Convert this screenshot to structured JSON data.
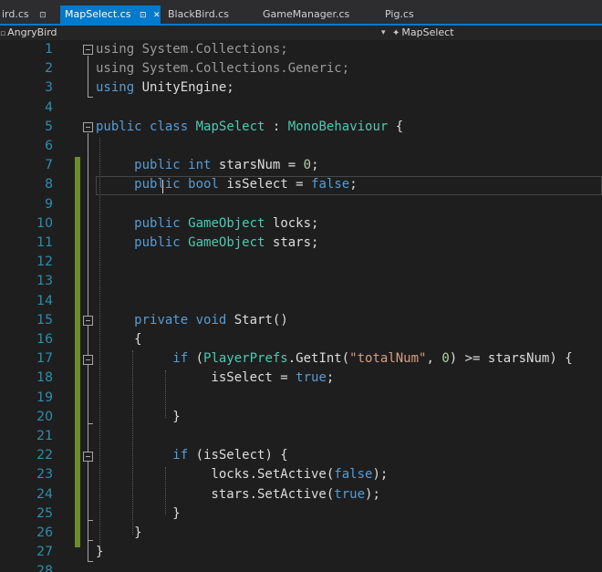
{
  "tabs": [
    {
      "label": "ird.cs",
      "icon": "pin-icon",
      "active": false
    },
    {
      "label": "MapSelect.cs",
      "icon": "pin-icon",
      "active": true
    },
    {
      "label": "BlackBird.cs",
      "active": false
    },
    {
      "label": "GameManager.cs",
      "active": false
    },
    {
      "label": "Pig.cs",
      "active": false
    }
  ],
  "navbar": {
    "project": "AngryBird",
    "member": "MapSelect",
    "dropdown_glyph": "▾"
  },
  "editor": {
    "theme": {
      "keyword": "#569cd6",
      "type": "#4ec9b0",
      "string": "#d69d85",
      "number": "#b5cea8",
      "line_number": "#2b91af",
      "text": "#dcdcdc",
      "changed": "#6a8d2c"
    },
    "lines": [
      {
        "num": "1",
        "tokens": [
          [
            "u",
            "using"
          ],
          [
            "u",
            " System.Collections;"
          ]
        ]
      },
      {
        "num": "2",
        "tokens": [
          [
            "u",
            "using"
          ],
          [
            "u",
            " System.Collections.Generic;"
          ]
        ]
      },
      {
        "num": "3",
        "tokens": [
          [
            "k",
            "using"
          ],
          [
            "p",
            " UnityEngine;"
          ]
        ]
      },
      {
        "num": "4",
        "tokens": []
      },
      {
        "num": "5",
        "tokens": [
          [
            "k",
            "public"
          ],
          [
            "p",
            " "
          ],
          [
            "k",
            "class"
          ],
          [
            "p",
            " "
          ],
          [
            "t",
            "MapSelect"
          ],
          [
            "p",
            " : "
          ],
          [
            "t",
            "MonoBehaviour"
          ],
          [
            "p",
            " {"
          ]
        ]
      },
      {
        "num": "6",
        "tokens": []
      },
      {
        "num": "7",
        "tokens": [
          [
            "p",
            "     "
          ],
          [
            "k",
            "public"
          ],
          [
            "p",
            " "
          ],
          [
            "k",
            "int"
          ],
          [
            "p",
            " starsNum = "
          ],
          [
            "n",
            "0"
          ],
          [
            "p",
            ";"
          ]
        ]
      },
      {
        "num": "8",
        "tokens": [
          [
            "p",
            "     "
          ],
          [
            "k",
            "public"
          ],
          [
            "p",
            " "
          ],
          [
            "k",
            "bool"
          ],
          [
            "p",
            " isSelect = "
          ],
          [
            "k",
            "false"
          ],
          [
            "p",
            ";"
          ]
        ]
      },
      {
        "num": "9",
        "tokens": []
      },
      {
        "num": "10",
        "tokens": [
          [
            "p",
            "     "
          ],
          [
            "k",
            "public"
          ],
          [
            "p",
            " "
          ],
          [
            "t",
            "GameObject"
          ],
          [
            "p",
            " locks;"
          ]
        ]
      },
      {
        "num": "11",
        "tokens": [
          [
            "p",
            "     "
          ],
          [
            "k",
            "public"
          ],
          [
            "p",
            " "
          ],
          [
            "t",
            "GameObject"
          ],
          [
            "p",
            " stars;"
          ]
        ]
      },
      {
        "num": "12",
        "tokens": []
      },
      {
        "num": "13",
        "tokens": []
      },
      {
        "num": "14",
        "tokens": []
      },
      {
        "num": "15",
        "tokens": [
          [
            "p",
            "     "
          ],
          [
            "k",
            "private"
          ],
          [
            "p",
            " "
          ],
          [
            "k",
            "void"
          ],
          [
            "p",
            " Start()"
          ]
        ]
      },
      {
        "num": "16",
        "tokens": [
          [
            "p",
            "     {"
          ]
        ]
      },
      {
        "num": "17",
        "tokens": [
          [
            "p",
            "          "
          ],
          [
            "k",
            "if"
          ],
          [
            "p",
            " ("
          ],
          [
            "t",
            "PlayerPrefs"
          ],
          [
            "p",
            ".GetInt("
          ],
          [
            "s",
            "\"totalNum\""
          ],
          [
            "p",
            ", "
          ],
          [
            "n",
            "0"
          ],
          [
            "p",
            ") >= starsNum) {"
          ]
        ]
      },
      {
        "num": "18",
        "tokens": [
          [
            "p",
            "               isSelect = "
          ],
          [
            "k",
            "true"
          ],
          [
            "p",
            ";"
          ]
        ]
      },
      {
        "num": "19",
        "tokens": []
      },
      {
        "num": "20",
        "tokens": [
          [
            "p",
            "          }"
          ]
        ]
      },
      {
        "num": "21",
        "tokens": []
      },
      {
        "num": "22",
        "tokens": [
          [
            "p",
            "          "
          ],
          [
            "k",
            "if"
          ],
          [
            "p",
            " (isSelect) {"
          ]
        ]
      },
      {
        "num": "23",
        "tokens": [
          [
            "p",
            "               locks.SetActive("
          ],
          [
            "k",
            "false"
          ],
          [
            "p",
            ");"
          ]
        ]
      },
      {
        "num": "24",
        "tokens": [
          [
            "p",
            "               stars.SetActive("
          ],
          [
            "k",
            "true"
          ],
          [
            "p",
            ");"
          ]
        ]
      },
      {
        "num": "25",
        "tokens": [
          [
            "p",
            "          }"
          ]
        ]
      },
      {
        "num": "26",
        "tokens": [
          [
            "p",
            "     }"
          ]
        ]
      },
      {
        "num": "27",
        "tokens": [
          [
            "p",
            "}"
          ]
        ]
      },
      {
        "num": "28",
        "tokens": []
      }
    ]
  }
}
